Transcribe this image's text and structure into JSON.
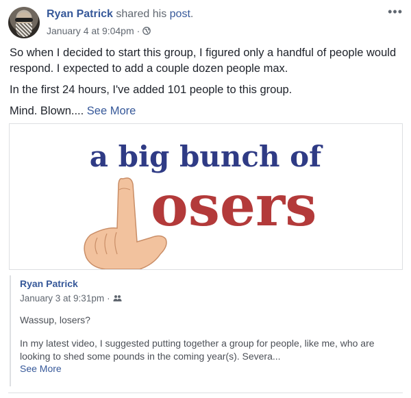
{
  "post": {
    "author_name": "Ryan Patrick",
    "shared_text": " shared his ",
    "post_link": "post",
    "post_punct": ".",
    "timestamp": "January 4 at 9:04pm",
    "meta_separator": "·",
    "privacy_icon": "globe-icon",
    "more_icon": "more-options-icon",
    "more_glyph": "•••",
    "paragraphs": [
      "So when I decided to start this group, I figured only a handful of people would respond. I expected to add a couple dozen people max.",
      "In the first 24 hours, I've added 101 people to this group."
    ],
    "last_paragraph": "Mind. Blown.... ",
    "see_more": "See More"
  },
  "attachment": {
    "headline": "a big bunch of",
    "big_word": "osers",
    "colors": {
      "headline": "#2f3b85",
      "big_word": "#b33a3a",
      "skin": "#f2c29e"
    }
  },
  "quoted": {
    "author_name": "Ryan Patrick",
    "timestamp": "January 3 at 9:31pm",
    "meta_separator": "·",
    "audience_icon": "group-icon",
    "text1": "Wassup, losers?",
    "text2": "In my latest video, I suggested putting together a group for people, like me, who are looking to shed some pounds in the coming year(s). Severa...",
    "see_more": "See More"
  },
  "colors": {
    "link": "#365899",
    "meta": "#606770",
    "text": "#1d2129",
    "border": "#dddfe2"
  }
}
